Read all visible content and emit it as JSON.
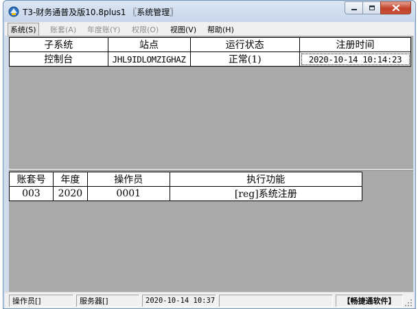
{
  "window": {
    "title": "T3-财务通普及版10.8plus1 〖系统管理〗"
  },
  "menu": [
    {
      "label": "系统(S)",
      "state": "active"
    },
    {
      "label": "账套(A)",
      "state": "disabled"
    },
    {
      "label": "年度账(Y)",
      "state": "disabled"
    },
    {
      "label": "权限(O)",
      "state": "disabled"
    },
    {
      "label": "视图(V)",
      "state": "enabled"
    },
    {
      "label": "帮助(H)",
      "state": "enabled"
    }
  ],
  "subsystems_table": {
    "headers": [
      "子系统",
      "站点",
      "运行状态",
      "注册时间"
    ],
    "rows": [
      [
        "控制台",
        "JHL9IDLOMZIGHAZ",
        "正常(1)",
        "2020-10-14 10:14:23"
      ]
    ]
  },
  "operations_table": {
    "headers": [
      "账套号",
      "年度",
      "操作员",
      "执行功能"
    ],
    "rows": [
      [
        "003",
        "2020",
        "0001",
        "[reg]系统注册"
      ]
    ]
  },
  "status": {
    "operator": "操作员[]",
    "server": "服务器[]",
    "datetime": "2020-10-14 10:37",
    "empty": "",
    "brand": "【畅捷通软件】"
  },
  "icons": {
    "app": "t3-app-icon",
    "minimize": "minimize-icon",
    "maximize": "maximize-icon",
    "close": "close-icon"
  },
  "colors": {
    "client_background": "#a9a9a9",
    "close_button": "#c3412a",
    "titlebar": "#c6d6ea"
  }
}
